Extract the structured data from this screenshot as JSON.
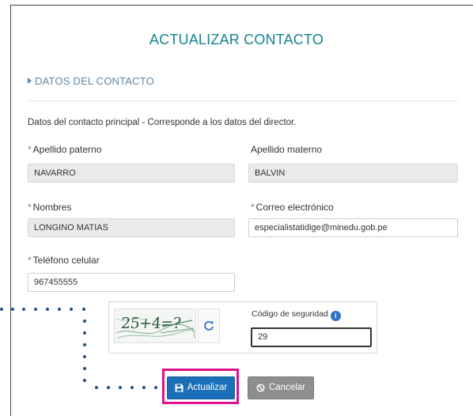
{
  "form": {
    "title": "ACTUALIZAR CONTACTO",
    "section_title": "DATOS DEL CONTACTO",
    "description": "Datos del contacto principal - Corresponde a los datos del director."
  },
  "fields": {
    "apellido_paterno": {
      "label": "Apellido paterno",
      "required_mark": "*",
      "value": "NAVARRO"
    },
    "apellido_materno": {
      "label": "Apellido materno",
      "value": "BALVIN"
    },
    "nombres": {
      "label": "Nombres",
      "required_mark": "*",
      "value": "LONGINO MATIAS"
    },
    "correo": {
      "label": "Correo electrónico",
      "required_mark": "*",
      "value": "especialistatidige@minedu.gob.pe"
    },
    "telefono": {
      "label": "Teléfono celular",
      "required_mark": "*",
      "value": "967455555"
    }
  },
  "captcha": {
    "image_text": "25+4=?",
    "security_label": "Código de seguridad",
    "info_icon": "info-icon",
    "security_value": "29"
  },
  "buttons": {
    "update_label": "Actualizar",
    "update_icon": "floppy-disk-icon",
    "cancel_label": "Cancelar",
    "cancel_icon": "ban-icon"
  },
  "colors": {
    "title": "#14838f",
    "section": "#5f86a6",
    "primary_button": "#1b6fb8",
    "cancel_button": "#8e8e8e",
    "highlight": "#e0118c",
    "dotted_guide": "#1d4f8a"
  }
}
